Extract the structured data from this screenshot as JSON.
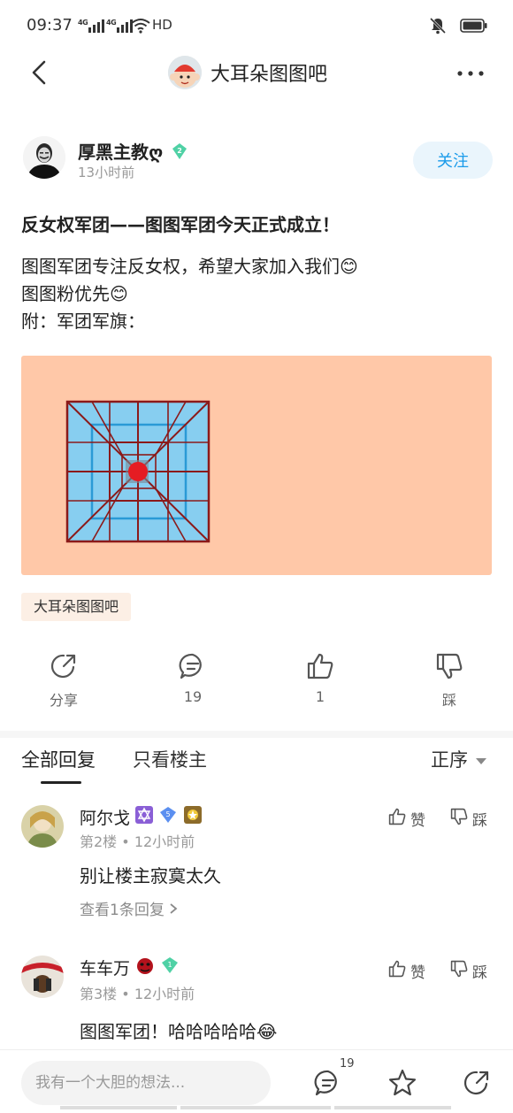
{
  "status_bar": {
    "time": "09:37",
    "network": "4G 4G",
    "hd": "HD"
  },
  "header": {
    "forum_name": "大耳朵图图吧"
  },
  "post": {
    "author": {
      "name": "厚黑主教ღ",
      "level": "2",
      "time": "13小时前"
    },
    "follow_label": "关注",
    "title": "反女权军团——图图军团今天正式成立！",
    "body_lines": [
      "图图军团专注反女权，希望大家加入我们😊",
      "图图粉优先😊",
      "附：军团军旗："
    ],
    "forum_tag": "大耳朵图图吧",
    "colors": {
      "flag_bg": "#ffc8a8",
      "grid_fill": "#87cef0",
      "grid_line": "#8b1a1a",
      "center_dot": "#e51c23"
    }
  },
  "actions": {
    "share": "分享",
    "comments": "19",
    "likes": "1",
    "dislike": "踩"
  },
  "tabs": {
    "all": "全部回复",
    "op_only": "只看楼主",
    "sort": "正序"
  },
  "replies": [
    {
      "name": "阿尔戈",
      "badge_level": "5",
      "floor": "第2楼",
      "time": "12小时前",
      "text": "别让楼主寂寞太久",
      "more": "查看1条回复",
      "like": "赞",
      "dislike": "踩"
    },
    {
      "name": "车车万",
      "badge_level": "1",
      "floor": "第3楼",
      "time": "12小时前",
      "text": "图图军团！哈哈哈哈哈😂",
      "like": "赞",
      "dislike": "踩"
    }
  ],
  "bottom": {
    "placeholder": "我有一个大胆的想法...",
    "comment_count": "19"
  }
}
